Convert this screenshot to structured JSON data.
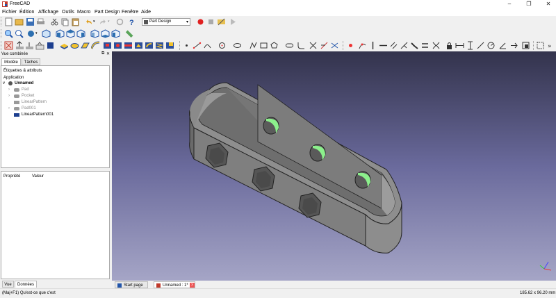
{
  "window": {
    "title": "FreeCAD"
  },
  "menu": [
    "Fichier",
    "Édition",
    "Affichage",
    "Outils",
    "Macro",
    "Part Design",
    "Fenêtre",
    "Aide"
  ],
  "workbench": {
    "selected": "Part Design"
  },
  "combo": {
    "title": "Vue combinée",
    "tabs": [
      "Modèle",
      "Tâches"
    ]
  },
  "tree": {
    "section": "Étiquettes & attributs",
    "root": "Application",
    "doc": "Unnamed",
    "items": [
      "Pad",
      "Pocket",
      "LinearPattern",
      "Pad001",
      "LinearPattern001"
    ]
  },
  "props": {
    "col1": "Propriété",
    "col2": "Valeur",
    "tabs": [
      "Vue",
      "Données"
    ]
  },
  "doc_tabs": [
    "Start page",
    "Unnamed : 1*"
  ],
  "status": {
    "left": "(Maj+F1) Qu'est-ce que c'est",
    "right": "185.62 x 96.20 mm"
  },
  "colors": {
    "accent": "#c0392b",
    "viewport_top": "#33334c",
    "viewport_bottom": "#a5a5c6",
    "part": "#8a8a8a",
    "hole": "#8cf08c"
  }
}
